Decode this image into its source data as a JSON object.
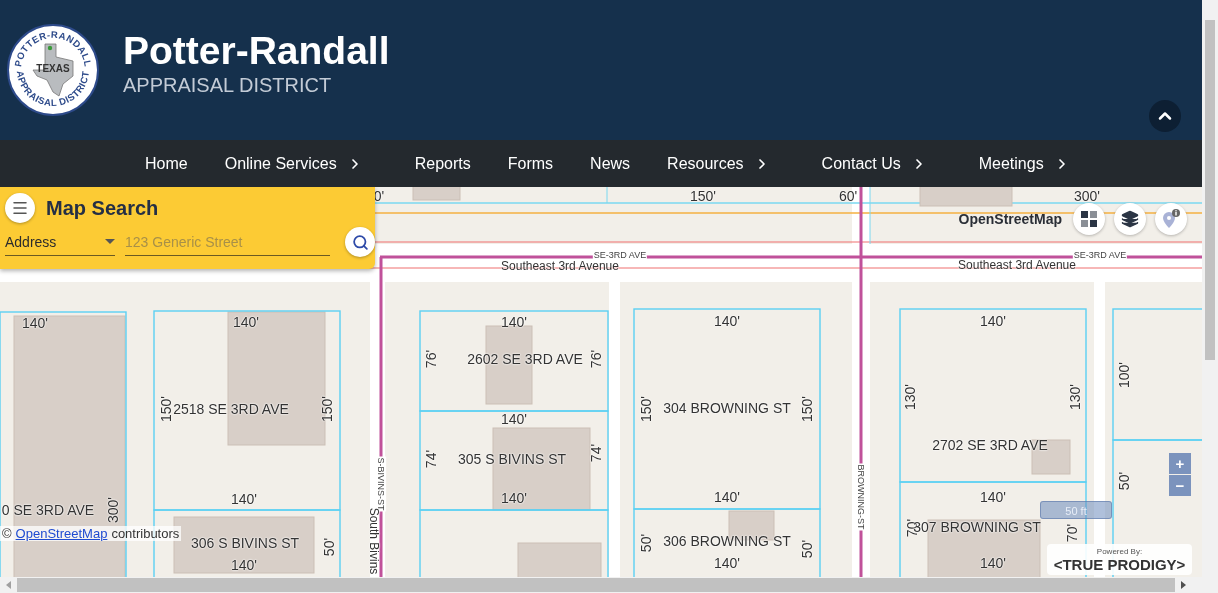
{
  "header": {
    "logo": {
      "top_text": "POTTER-RANDALL",
      "center_text": "TEXAS",
      "bottom_text": "APPRAISAL DISTRICT"
    },
    "title": "Potter-Randall",
    "subtitle": "APPRAISAL DISTRICT"
  },
  "nav": [
    {
      "label": "Home",
      "has_submenu": false
    },
    {
      "label": "Online Services",
      "has_submenu": true
    },
    {
      "label": "Reports",
      "has_submenu": false
    },
    {
      "label": "Forms",
      "has_submenu": false
    },
    {
      "label": "News",
      "has_submenu": false
    },
    {
      "label": "Resources",
      "has_submenu": true
    },
    {
      "label": "Contact Us",
      "has_submenu": true
    },
    {
      "label": "Meetings",
      "has_submenu": true
    }
  ],
  "map_search": {
    "title": "Map Search",
    "search_by": "Address",
    "placeholder": "123 Generic Street"
  },
  "basemap_label": "OpenStreetMap",
  "map_labels": [
    {
      "kind": "dimension",
      "text": "0'",
      "vertical": false
    },
    {
      "kind": "dimension",
      "text": "150'",
      "vertical": false
    },
    {
      "kind": "dimension",
      "text": "60'",
      "vertical": false
    },
    {
      "kind": "dimension",
      "text": "300'",
      "vertical": false
    },
    {
      "kind": "shield",
      "text": "SE-3RD AVE",
      "vertical": false
    },
    {
      "kind": "shield",
      "text": "SE-3RD AVE",
      "vertical": false
    },
    {
      "kind": "street",
      "text": "Southeast 3rd Avenue",
      "vertical": false
    },
    {
      "kind": "street",
      "text": "Southeast 3rd Avenue",
      "vertical": false
    },
    {
      "kind": "dimension",
      "text": "140'",
      "vertical": false
    },
    {
      "kind": "dimension",
      "text": "140'",
      "vertical": false
    },
    {
      "kind": "dimension",
      "text": "140'",
      "vertical": false
    },
    {
      "kind": "dimension",
      "text": "140'",
      "vertical": false
    },
    {
      "kind": "dimension",
      "text": "140'",
      "vertical": false
    },
    {
      "kind": "dimension",
      "text": "76'",
      "vertical": true
    },
    {
      "kind": "parcel",
      "text": "2602 SE 3RD AVE",
      "vertical": false
    },
    {
      "kind": "dimension",
      "text": "76'",
      "vertical": true
    },
    {
      "kind": "dimension",
      "text": "100'",
      "vertical": true
    },
    {
      "kind": "dimension",
      "text": "130'",
      "vertical": true
    },
    {
      "kind": "dimension",
      "text": "130'",
      "vertical": true
    },
    {
      "kind": "dimension",
      "text": "150'",
      "vertical": true
    },
    {
      "kind": "parcel",
      "text": "2518 SE 3RD AVE",
      "vertical": false
    },
    {
      "kind": "dimension",
      "text": "150'",
      "vertical": true
    },
    {
      "kind": "dimension",
      "text": "150'",
      "vertical": true
    },
    {
      "kind": "parcel",
      "text": "304  BROWNING ST",
      "vertical": false
    },
    {
      "kind": "dimension",
      "text": "150'",
      "vertical": true
    },
    {
      "kind": "dimension",
      "text": "140'",
      "vertical": false
    },
    {
      "kind": "parcel",
      "text": "2702 SE 3RD AVE",
      "vertical": false
    },
    {
      "kind": "dimension",
      "text": "74'",
      "vertical": true
    },
    {
      "kind": "parcel",
      "text": "305 S BIVINS ST",
      "vertical": false
    },
    {
      "kind": "dimension",
      "text": "74'",
      "vertical": true
    },
    {
      "kind": "dimension",
      "text": "50'",
      "vertical": true
    },
    {
      "kind": "shield",
      "text": "S-BIVINS-ST",
      "vertical": true
    },
    {
      "kind": "shield",
      "text": "BROWNING-ST",
      "vertical": true
    },
    {
      "kind": "dimension",
      "text": "140'",
      "vertical": false
    },
    {
      "kind": "dimension",
      "text": "140'",
      "vertical": false
    },
    {
      "kind": "dimension",
      "text": "140'",
      "vertical": false
    },
    {
      "kind": "dimension",
      "text": "140'",
      "vertical": false
    },
    {
      "kind": "parcel",
      "text": "0 SE 3RD AVE",
      "vertical": false
    },
    {
      "kind": "dimension",
      "text": "300'",
      "vertical": true
    },
    {
      "kind": "dimension",
      "text": "70'",
      "vertical": true
    },
    {
      "kind": "parcel",
      "text": "307  BROWNING ST",
      "vertical": false
    },
    {
      "kind": "dimension",
      "text": "70'",
      "vertical": true
    },
    {
      "kind": "dimension",
      "text": "50'",
      "vertical": true
    },
    {
      "kind": "parcel",
      "text": "306 S BIVINS ST",
      "vertical": false
    },
    {
      "kind": "dimension",
      "text": "50'",
      "vertical": true
    },
    {
      "kind": "parcel",
      "text": "306  BROWNING ST",
      "vertical": false
    },
    {
      "kind": "dimension",
      "text": "50'",
      "vertical": true
    },
    {
      "kind": "street",
      "text": "South Bivins",
      "vertical": true
    },
    {
      "kind": "dimension",
      "text": "140'",
      "vertical": false
    },
    {
      "kind": "dimension",
      "text": "140'",
      "vertical": false
    },
    {
      "kind": "dimension",
      "text": "140'",
      "vertical": false
    }
  ],
  "zoom": {
    "in": "+",
    "out": "−"
  },
  "scale": "50 ft",
  "attribution": {
    "prefix": "©",
    "link": "OpenStreetMap",
    "suffix": "contributors"
  },
  "powered_by": {
    "caption": "Powered By:",
    "brand": "<TRUE PRODIGY>"
  }
}
